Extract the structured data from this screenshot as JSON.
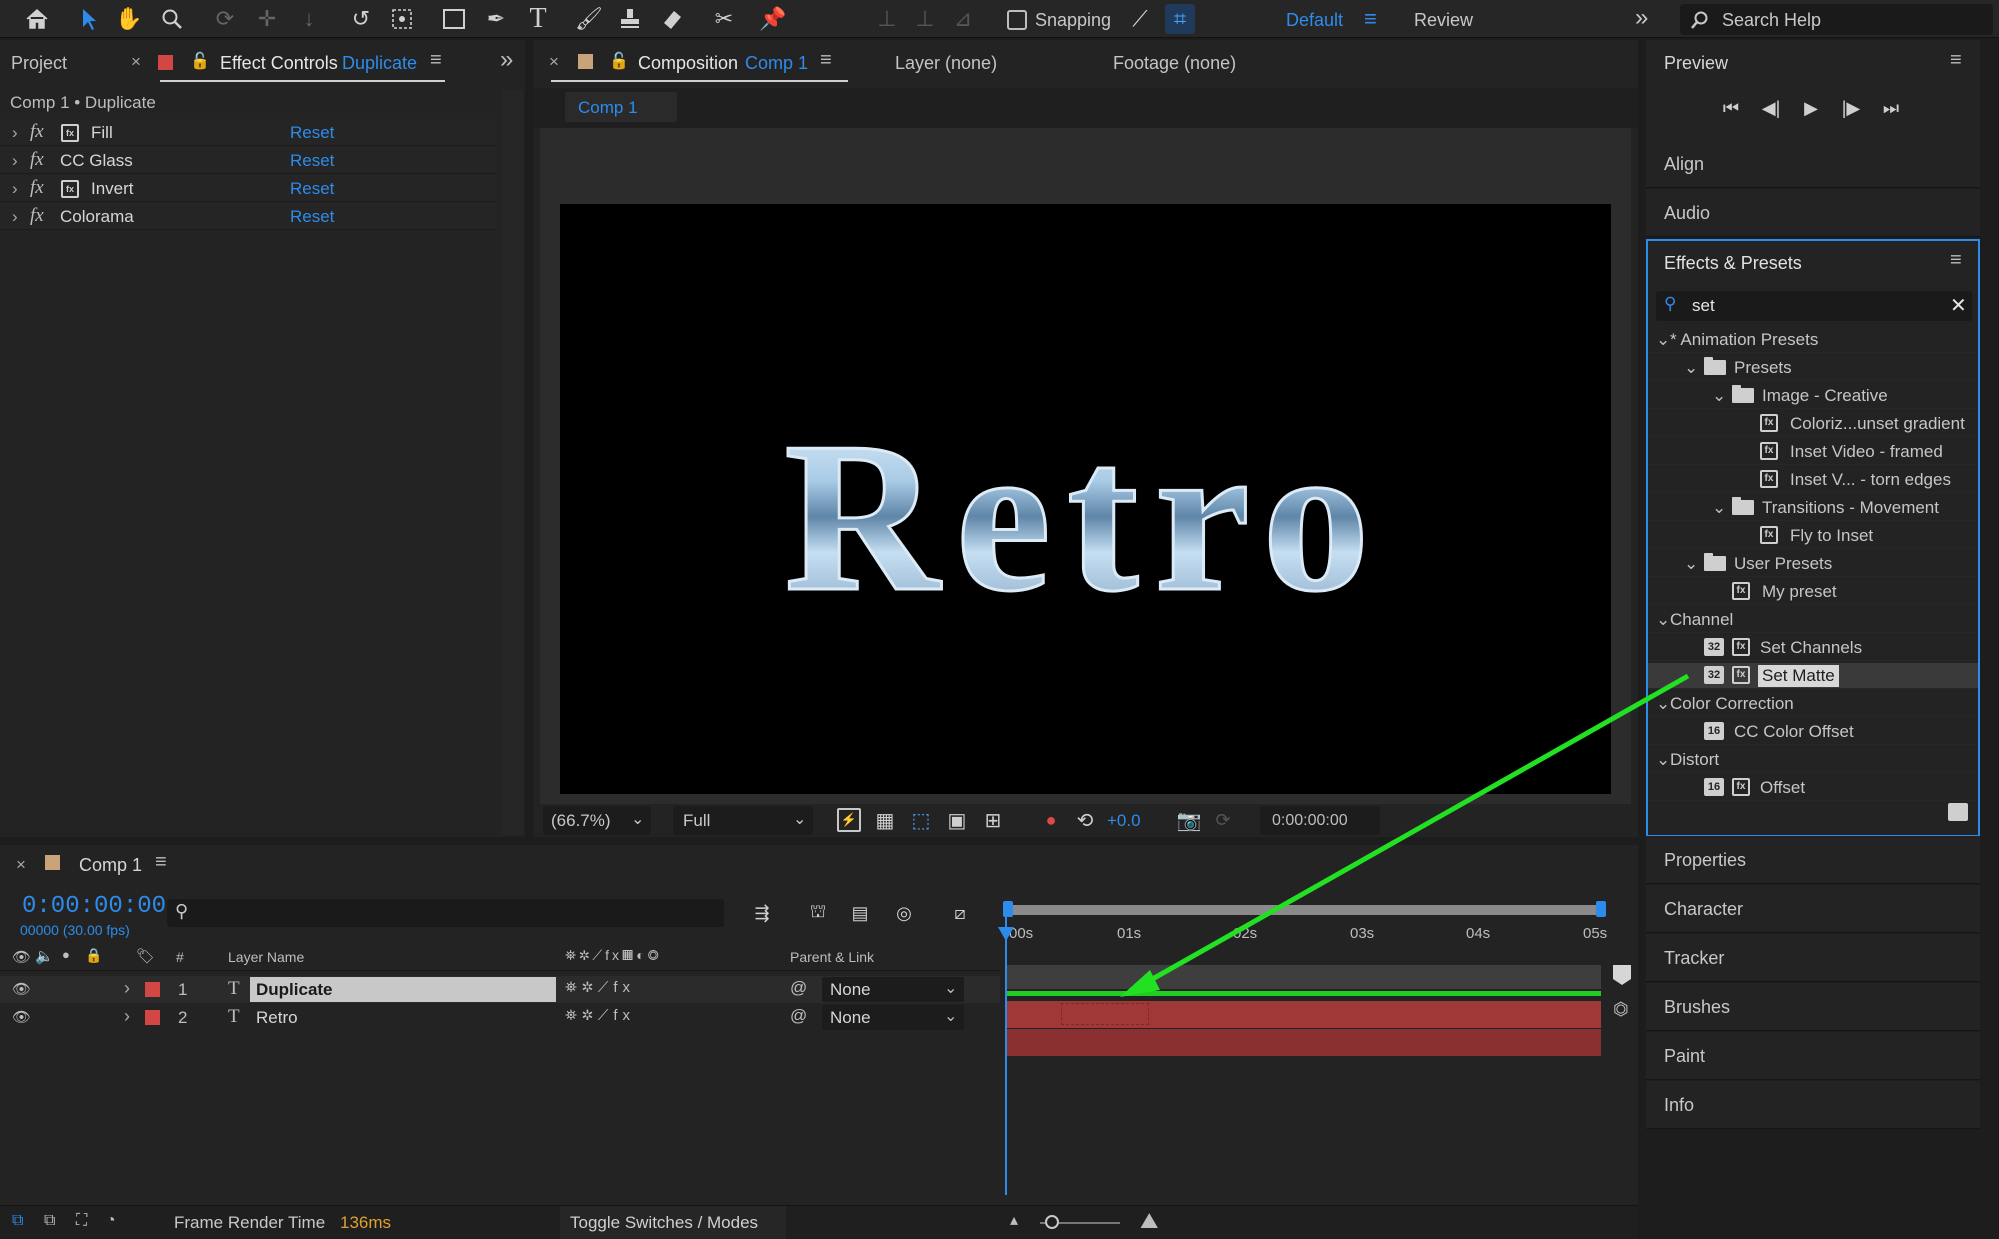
{
  "toolbar": {
    "snapping_label": "Snapping",
    "workspace_default": "Default",
    "workspace_review": "Review",
    "search_help_placeholder": "Search Help"
  },
  "left_panel": {
    "tab_project": "Project",
    "tab_effect_controls": "Effect Controls",
    "tab_effect_controls_layer": "Duplicate",
    "breadcrumb": "Comp 1 • Duplicate",
    "effects": [
      {
        "name": "Fill",
        "reset": "Reset"
      },
      {
        "name": "CC Glass",
        "reset": "Reset"
      },
      {
        "name": "Invert",
        "reset": "Reset"
      },
      {
        "name": "Colorama",
        "reset": "Reset"
      }
    ]
  },
  "viewer": {
    "tab_composition": "Composition",
    "tab_composition_name": "Comp 1",
    "tab_layer": "Layer (none)",
    "tab_footage": "Footage (none)",
    "comp_chip": "Comp 1",
    "canvas_text": "Retro",
    "zoom": "(66.7%)",
    "resolution": "Full",
    "exposure": "+0.0",
    "timecode": "0:00:00:00"
  },
  "right_panel": {
    "preview_title": "Preview",
    "align": "Align",
    "audio": "Audio",
    "effects_title": "Effects & Presets",
    "search_value": "set",
    "tree": [
      {
        "label": "* Animation Presets",
        "level": 0,
        "type": "group"
      },
      {
        "label": "Presets",
        "level": 1,
        "type": "folder"
      },
      {
        "label": "Image - Creative",
        "level": 2,
        "type": "folder"
      },
      {
        "label": "Coloriz...unset gradient",
        "level": 3,
        "type": "preset"
      },
      {
        "label": "Inset Video - framed",
        "level": 3,
        "type": "preset"
      },
      {
        "label": "Inset V... - torn edges",
        "level": 3,
        "type": "preset"
      },
      {
        "label": "Transitions - Movement",
        "level": 2,
        "type": "folder"
      },
      {
        "label": "Fly to Inset",
        "level": 3,
        "type": "preset"
      },
      {
        "label": "User Presets",
        "level": 1,
        "type": "folder"
      },
      {
        "label": "My preset",
        "level": 2,
        "type": "preset"
      },
      {
        "label": "Channel",
        "level": 0,
        "type": "group"
      },
      {
        "label": "Set Channels",
        "level": 1,
        "type": "effect",
        "badge": "32"
      },
      {
        "label": "Set Matte",
        "level": 1,
        "type": "effect",
        "badge": "32",
        "selected": true
      },
      {
        "label": "Color Correction",
        "level": 0,
        "type": "group"
      },
      {
        "label": "CC Color Offset",
        "level": 1,
        "type": "effect",
        "badge": "16"
      },
      {
        "label": "Distort",
        "level": 0,
        "type": "group"
      },
      {
        "label": "Offset",
        "level": 1,
        "type": "effect",
        "badge": "16"
      }
    ],
    "lower_panels": [
      "Properties",
      "Character",
      "Tracker",
      "Brushes",
      "Paint",
      "Info"
    ]
  },
  "timeline": {
    "tab_name": "Comp 1",
    "timecode": "0:00:00:00",
    "frames": "00000 (30.00 fps)",
    "ruler_labels": [
      "00s",
      "01s",
      "02s",
      "03s",
      "04s",
      "05s"
    ],
    "col_number": "#",
    "col_layer_name": "Layer Name",
    "col_parent_link": "Parent & Link",
    "layers": [
      {
        "num": "1",
        "name": "Duplicate",
        "parent": "None",
        "selected": true
      },
      {
        "num": "2",
        "name": "Retro",
        "parent": "None",
        "selected": false
      }
    ],
    "footer_render_label": "Frame Render Time",
    "footer_render_value": "136ms",
    "footer_toggle": "Toggle Switches / Modes"
  },
  "colors": {
    "accent_blue": "#2d8ceb",
    "layer_label_red": "#d24646",
    "annotation_arrow": "#22e022",
    "clip_bar": "#a03838"
  }
}
